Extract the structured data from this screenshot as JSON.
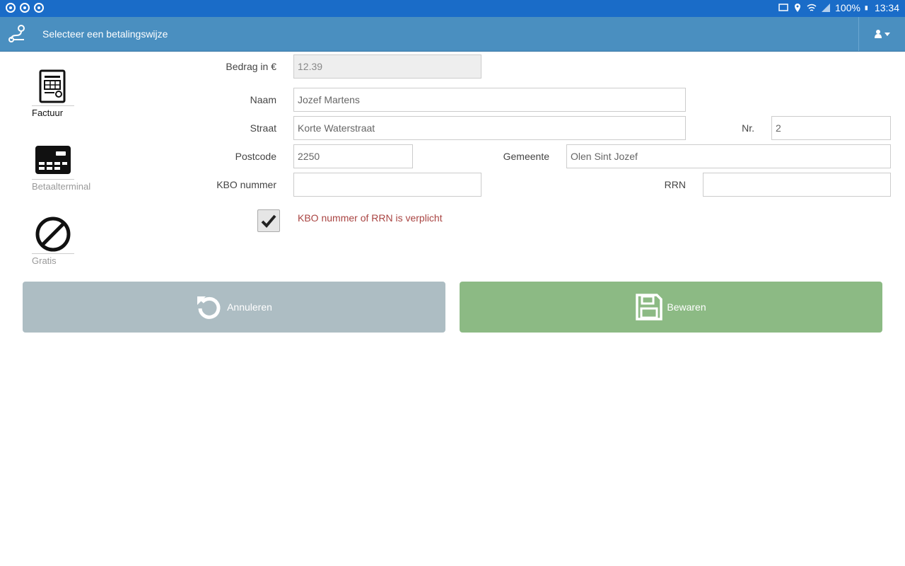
{
  "statusbar": {
    "battery": "100%",
    "time": "13:34"
  },
  "appbar": {
    "title": "Selecteer een betalingswijze"
  },
  "methods": [
    {
      "label": "Factuur",
      "icon": "invoice-icon",
      "active": true
    },
    {
      "label": "Betaalterminal",
      "icon": "card-terminal-icon",
      "active": false
    },
    {
      "label": "Gratis",
      "icon": "prohibited-icon",
      "active": false
    }
  ],
  "form": {
    "amount_label": "Bedrag in €",
    "amount_value": "12.39",
    "name_label": "Naam",
    "name_value": "Jozef Martens",
    "street_label": "Straat",
    "street_value": "Korte Waterstraat",
    "nr_label": "Nr.",
    "nr_value": "2",
    "postcode_label": "Postcode",
    "postcode_value": "2250",
    "municipality_label": "Gemeente",
    "municipality_value": "Olen Sint Jozef",
    "kbo_label": "KBO nummer",
    "kbo_value": "",
    "rrn_label": "RRN",
    "rrn_value": "",
    "required_checked": true,
    "warning": "KBO nummer of RRN is verplicht"
  },
  "buttons": {
    "cancel_label": "Annuleren",
    "save_label": "Bewaren"
  },
  "colors": {
    "statusbar": "#1a6cc8",
    "appbar": "#4a8fc0",
    "cancel": "#adbdc3",
    "save": "#8cba84",
    "warning": "#a94442"
  }
}
